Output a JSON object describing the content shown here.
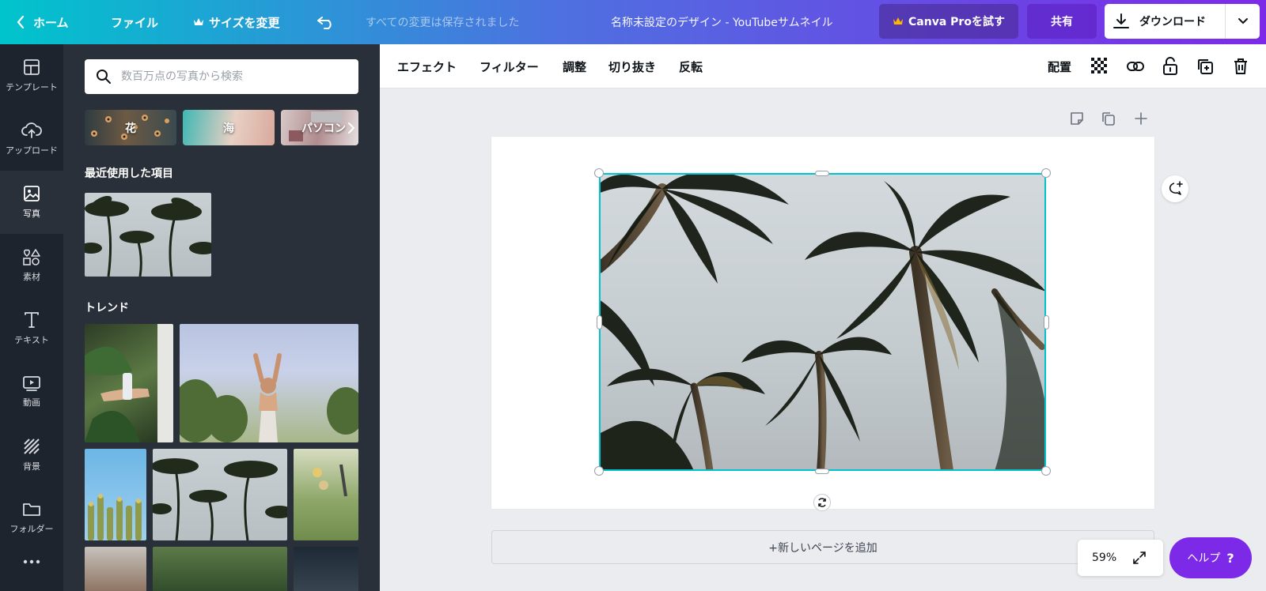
{
  "topbar": {
    "home_label": "ホーム",
    "file_label": "ファイル",
    "resize_label": "サイズを変更",
    "saved_status": "すべての変更は保存されました",
    "design_title": "名称未設定のデザイン - YouTubeサムネイル",
    "pro_label": "Canva Proを試す",
    "share_label": "共有",
    "download_label": "ダウンロード"
  },
  "nav": {
    "items": [
      {
        "label": "テンプレート",
        "icon": "layout-icon"
      },
      {
        "label": "アップロード",
        "icon": "upload-cloud-icon"
      },
      {
        "label": "写真",
        "icon": "photo-icon"
      },
      {
        "label": "素材",
        "icon": "elements-icon"
      },
      {
        "label": "テキスト",
        "icon": "text-icon"
      },
      {
        "label": "動画",
        "icon": "video-icon"
      },
      {
        "label": "背景",
        "icon": "background-icon"
      },
      {
        "label": "フォルダー",
        "icon": "folder-icon"
      }
    ]
  },
  "panel": {
    "search_placeholder": "数百万点の写真から検索",
    "chips": [
      "花",
      "海",
      "パソコン"
    ],
    "recent_title": "最近使用した項目",
    "trend_title": "トレンド"
  },
  "toolbar": {
    "items": [
      "エフェクト",
      "フィルター",
      "調整",
      "切り抜き",
      "反転"
    ],
    "arrange_label": "配置"
  },
  "canvas": {
    "add_page_label": "+新しいページを追加",
    "zoom": "59%",
    "help_label": "ヘルプ",
    "help_mark": "?"
  },
  "colors": {
    "accent_teal": "#00c4cc",
    "accent_purple": "#7d2ae8",
    "panel_bg": "#293039",
    "nav_bg": "#0e1318",
    "pro_crown": "#ffb400"
  }
}
